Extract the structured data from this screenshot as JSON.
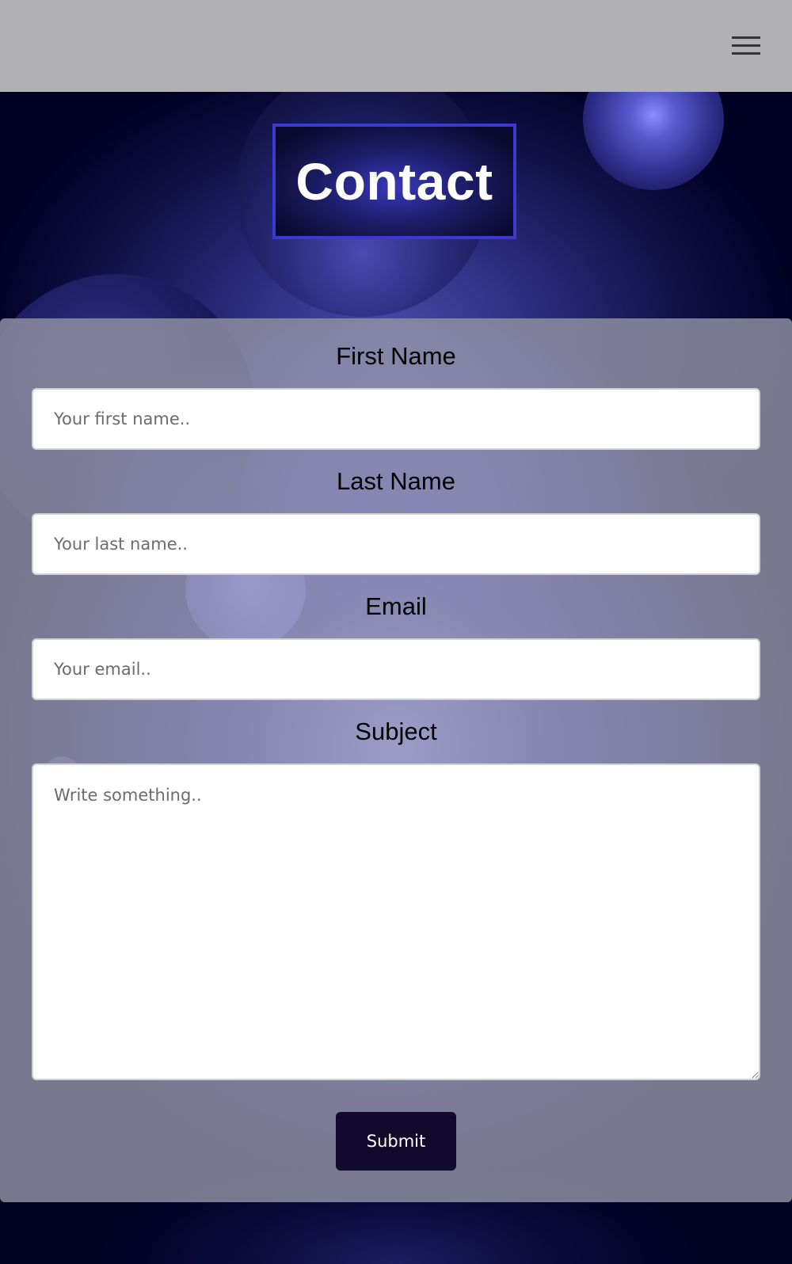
{
  "page": {
    "title": "Contact"
  },
  "nav": {
    "menu_icon": "hamburger-menu-icon"
  },
  "form": {
    "first_name": {
      "label": "First Name",
      "placeholder": "Your first name.."
    },
    "last_name": {
      "label": "Last Name",
      "placeholder": "Your last name.."
    },
    "email": {
      "label": "Email",
      "placeholder": "Your email.."
    },
    "subject": {
      "label": "Subject",
      "placeholder": "Write something.."
    },
    "submit_label": "Submit"
  },
  "colors": {
    "navbar": "#b1b1b3",
    "title_border": "#3a3ad0",
    "submit_bg": "#120a2c",
    "background": "#000022"
  }
}
